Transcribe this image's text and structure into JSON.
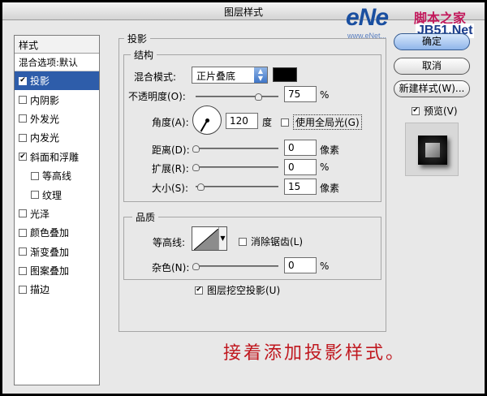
{
  "window": {
    "title": "图层样式"
  },
  "watermark": {
    "brand": "eNe",
    "site_cn": "脚本之家",
    "site_url": "JB51.Net",
    "sub_text": "www.eNet..."
  },
  "style_list": {
    "header": "样式",
    "blend_options": "混合选项:默认",
    "items": [
      {
        "label": "投影",
        "checked": true,
        "selected": true,
        "sub": false
      },
      {
        "label": "内阴影",
        "checked": false,
        "selected": false,
        "sub": false
      },
      {
        "label": "外发光",
        "checked": false,
        "selected": false,
        "sub": false
      },
      {
        "label": "内发光",
        "checked": false,
        "selected": false,
        "sub": false
      },
      {
        "label": "斜面和浮雕",
        "checked": true,
        "selected": false,
        "sub": false
      },
      {
        "label": "等高线",
        "checked": false,
        "selected": false,
        "sub": true
      },
      {
        "label": "纹理",
        "checked": false,
        "selected": false,
        "sub": true
      },
      {
        "label": "光泽",
        "checked": false,
        "selected": false,
        "sub": false
      },
      {
        "label": "颜色叠加",
        "checked": false,
        "selected": false,
        "sub": false
      },
      {
        "label": "渐变叠加",
        "checked": false,
        "selected": false,
        "sub": false
      },
      {
        "label": "图案叠加",
        "checked": false,
        "selected": false,
        "sub": false
      },
      {
        "label": "描边",
        "checked": false,
        "selected": false,
        "sub": false
      }
    ]
  },
  "drop_shadow": {
    "title": "投影",
    "structure": {
      "title": "结构",
      "blend_mode_label": "混合模式:",
      "blend_mode_value": "正片叠底",
      "shadow_color": "#000000",
      "opacity_label": "不透明度(O):",
      "opacity_value": "75",
      "opacity_unit": "%",
      "opacity_level": 0.75,
      "angle_label": "角度(A):",
      "angle_value": "120",
      "angle_unit": "度",
      "global_light_label": "使用全局光(G)",
      "global_light_checked": false,
      "distance_label": "距离(D):",
      "distance_value": "0",
      "distance_unit": "像素",
      "distance_level": 0,
      "spread_label": "扩展(R):",
      "spread_value": "0",
      "spread_unit": "%",
      "spread_level": 0,
      "size_label": "大小(S):",
      "size_value": "15",
      "size_unit": "像素",
      "size_level": 0.06
    },
    "quality": {
      "title": "品质",
      "contour_label": "等高线:",
      "antialias_label": "消除锯齿(L)",
      "antialias_checked": false,
      "noise_label": "杂色(N):",
      "noise_value": "0",
      "noise_unit": "%",
      "noise_level": 0
    },
    "knockout_label": "图层挖空投影(U)",
    "knockout_checked": true
  },
  "buttons": {
    "ok": "确定",
    "cancel": "取消",
    "new_style": "新建样式(W)...",
    "preview_label": "预览(V)",
    "preview_checked": true
  },
  "caption": "接着添加投影样式。"
}
